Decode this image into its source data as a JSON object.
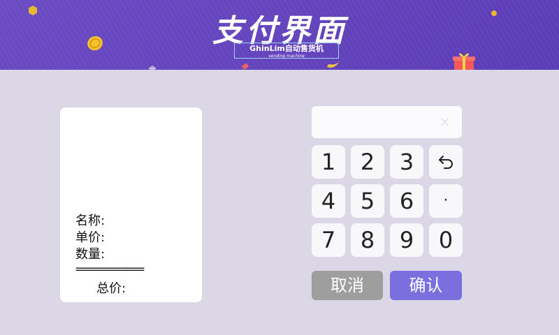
{
  "header": {
    "title": "支付界面",
    "brand": "GhinLim自动售货机",
    "brand_sub": "vending machine"
  },
  "product": {
    "name_label": "名称:",
    "price_label": "单价:",
    "qty_label": "数量:",
    "separator": "============",
    "total_label": "总价:"
  },
  "keypad": {
    "display_value": "",
    "clear_icon": "close-icon",
    "keys": [
      "1",
      "2",
      "3",
      "backspace",
      "4",
      "5",
      "6",
      "·",
      "7",
      "8",
      "9",
      "0"
    ],
    "backspace_icon": "backspace-icon"
  },
  "actions": {
    "cancel_label": "取消",
    "confirm_label": "确认"
  },
  "colors": {
    "header": "#6444bd",
    "background": "#dcd7e6",
    "cancel": "#9e9e9e",
    "confirm": "#7b6fe0"
  }
}
